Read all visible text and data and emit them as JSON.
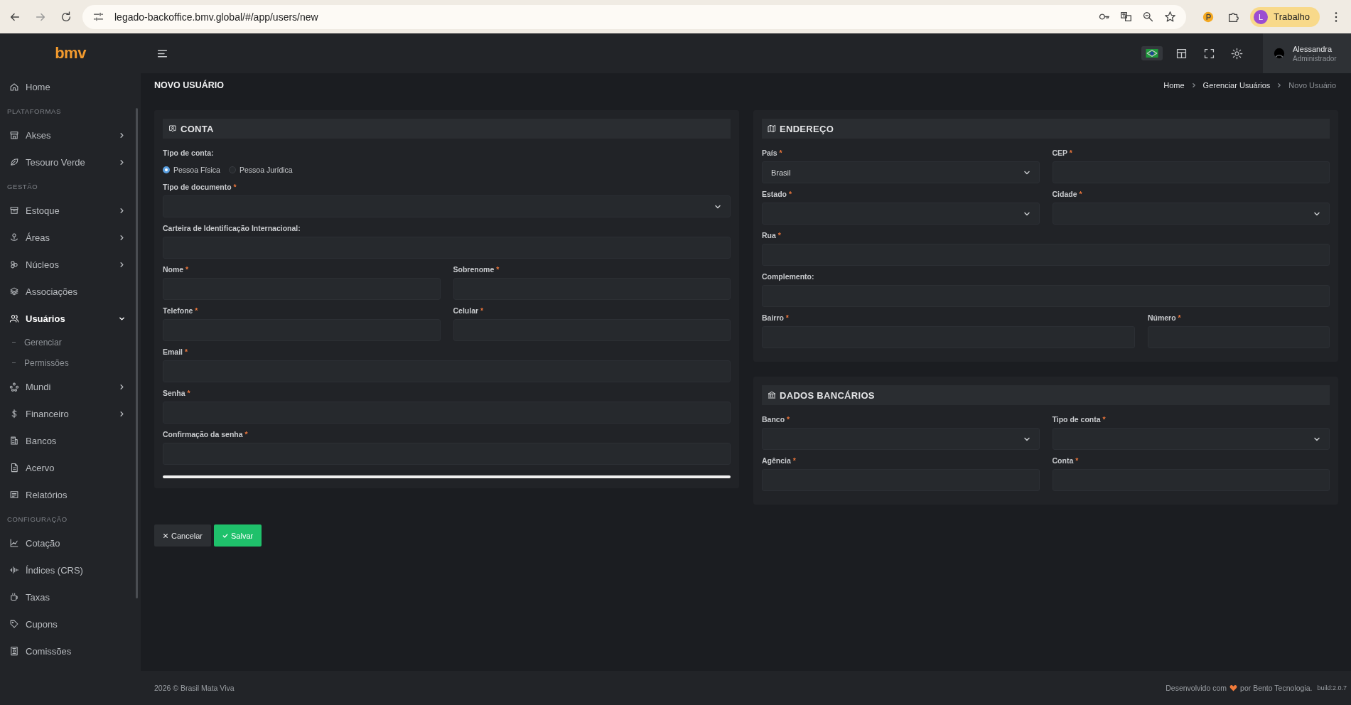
{
  "browser": {
    "url": "legado-backoffice.bmv.global/#/app/users/new",
    "profile": {
      "initial": "L",
      "name": "Trabalho"
    }
  },
  "logo": "bmv",
  "header": {
    "user": {
      "name": "Alessandra",
      "role": "Administrador"
    }
  },
  "sidebar": {
    "groups": [
      {
        "items": [
          {
            "label": "Home",
            "chevron": false,
            "selected": false
          }
        ]
      },
      {
        "heading": "PLATAFORMAS",
        "items": [
          {
            "label": "Akses",
            "chevron": true,
            "selected": false
          },
          {
            "label": "Tesouro Verde",
            "chevron": true,
            "selected": false
          }
        ]
      },
      {
        "heading": "GESTÃO",
        "items": [
          {
            "label": "Estoque",
            "chevron": true,
            "selected": false
          },
          {
            "label": "Áreas",
            "chevron": true,
            "selected": false
          },
          {
            "label": "Núcleos",
            "chevron": true,
            "selected": false
          },
          {
            "label": "Associações",
            "chevron": false,
            "selected": false
          },
          {
            "label": "Usuários",
            "chevron": true,
            "expanded": true,
            "selected": true,
            "children": [
              {
                "label": "Gerenciar"
              },
              {
                "label": "Permissões"
              }
            ]
          },
          {
            "label": "Mundi",
            "chevron": true,
            "selected": false
          },
          {
            "label": "Financeiro",
            "chevron": true,
            "selected": false
          },
          {
            "label": "Bancos",
            "chevron": false,
            "selected": false
          },
          {
            "label": "Acervo",
            "chevron": false,
            "selected": false
          },
          {
            "label": "Relatórios",
            "chevron": false,
            "selected": false
          }
        ]
      },
      {
        "heading": "CONFIGURAÇÃO",
        "items": [
          {
            "label": "Cotação",
            "chevron": false,
            "selected": false
          },
          {
            "label": "Índices (CRS)",
            "chevron": false,
            "selected": false
          },
          {
            "label": "Taxas",
            "chevron": false,
            "selected": false
          },
          {
            "label": "Cupons",
            "chevron": false,
            "selected": false
          },
          {
            "label": "Comissões",
            "chevron": false,
            "selected": false
          }
        ]
      }
    ]
  },
  "page": {
    "title": "NOVO USUÁRIO",
    "breadcrumbs": [
      {
        "label": "Home",
        "current": false
      },
      {
        "label": "Gerenciar Usuários",
        "current": false
      },
      {
        "label": "Novo Usuário",
        "current": true
      }
    ]
  },
  "sections": [
    {
      "title": "CONTA",
      "rows": [
        [
          {
            "kind": "radio",
            "label": "Tipo de conta:",
            "options": [
              {
                "label": "Pessoa Física",
                "selected": true
              },
              {
                "label": "Pessoa Jurídica",
                "selected": false
              }
            ]
          }
        ],
        [
          {
            "kind": "select",
            "label": "Tipo de documento",
            "required_mark": "*"
          }
        ],
        [
          {
            "kind": "input",
            "label": "Carteira de Identificação Internacional:"
          }
        ],
        [
          {
            "kind": "input",
            "label": "Nome",
            "required_mark": "*"
          },
          {
            "kind": "input",
            "label": "Sobrenome",
            "required_mark": "*"
          }
        ],
        [
          {
            "kind": "input",
            "label": "Telefone",
            "required_mark": "*"
          },
          {
            "kind": "input",
            "label": "Celular",
            "required_mark": "*"
          }
        ],
        [
          {
            "kind": "input",
            "label": "Email",
            "required_mark": "*"
          }
        ],
        [
          {
            "kind": "input",
            "label": "Senha",
            "required_mark": "*"
          }
        ],
        [
          {
            "kind": "input",
            "label": "Confirmação da senha",
            "required_mark": "*"
          }
        ],
        [
          {
            "kind": "meter",
            "level": 1
          }
        ]
      ]
    },
    {
      "title": "ENDEREÇO",
      "rows": [
        [
          {
            "kind": "select",
            "label": "País",
            "required_mark": "*",
            "value": "Brasil"
          },
          {
            "kind": "input",
            "label": "CEP",
            "required_mark": "*"
          }
        ],
        [
          {
            "kind": "select",
            "label": "Estado",
            "required_mark": "*"
          },
          {
            "kind": "select",
            "label": "Cidade",
            "required_mark": "*"
          }
        ],
        [
          {
            "kind": "input",
            "label": "Rua",
            "required_mark": "*"
          }
        ],
        [
          {
            "kind": "input",
            "label": "Complemento:"
          }
        ],
        [
          {
            "kind": "input",
            "label": "Bairro",
            "required_mark": "*"
          },
          {
            "kind": "input",
            "label": "Número",
            "required_mark": "*"
          }
        ]
      ]
    },
    {
      "title": "DADOS BANCÁRIOS",
      "rows": [
        [
          {
            "kind": "select",
            "label": "Banco",
            "required_mark": "*"
          },
          {
            "kind": "select",
            "label": "Tipo de conta",
            "required_mark": "*"
          }
        ],
        [
          {
            "kind": "input",
            "label": "Agência",
            "required_mark": "*"
          },
          {
            "kind": "input",
            "label": "Conta",
            "required_mark": "*"
          }
        ]
      ]
    }
  ],
  "actions": [
    {
      "kind": "cancel",
      "label": "Cancelar"
    },
    {
      "kind": "save",
      "label": "Salvar"
    }
  ],
  "footer": {
    "copyright": "2026 © Brasil Mata Viva",
    "credit_before": "Desenvolvido com",
    "credit_after": "por Bento Tecnologia.",
    "build": "build:2.0.7"
  }
}
